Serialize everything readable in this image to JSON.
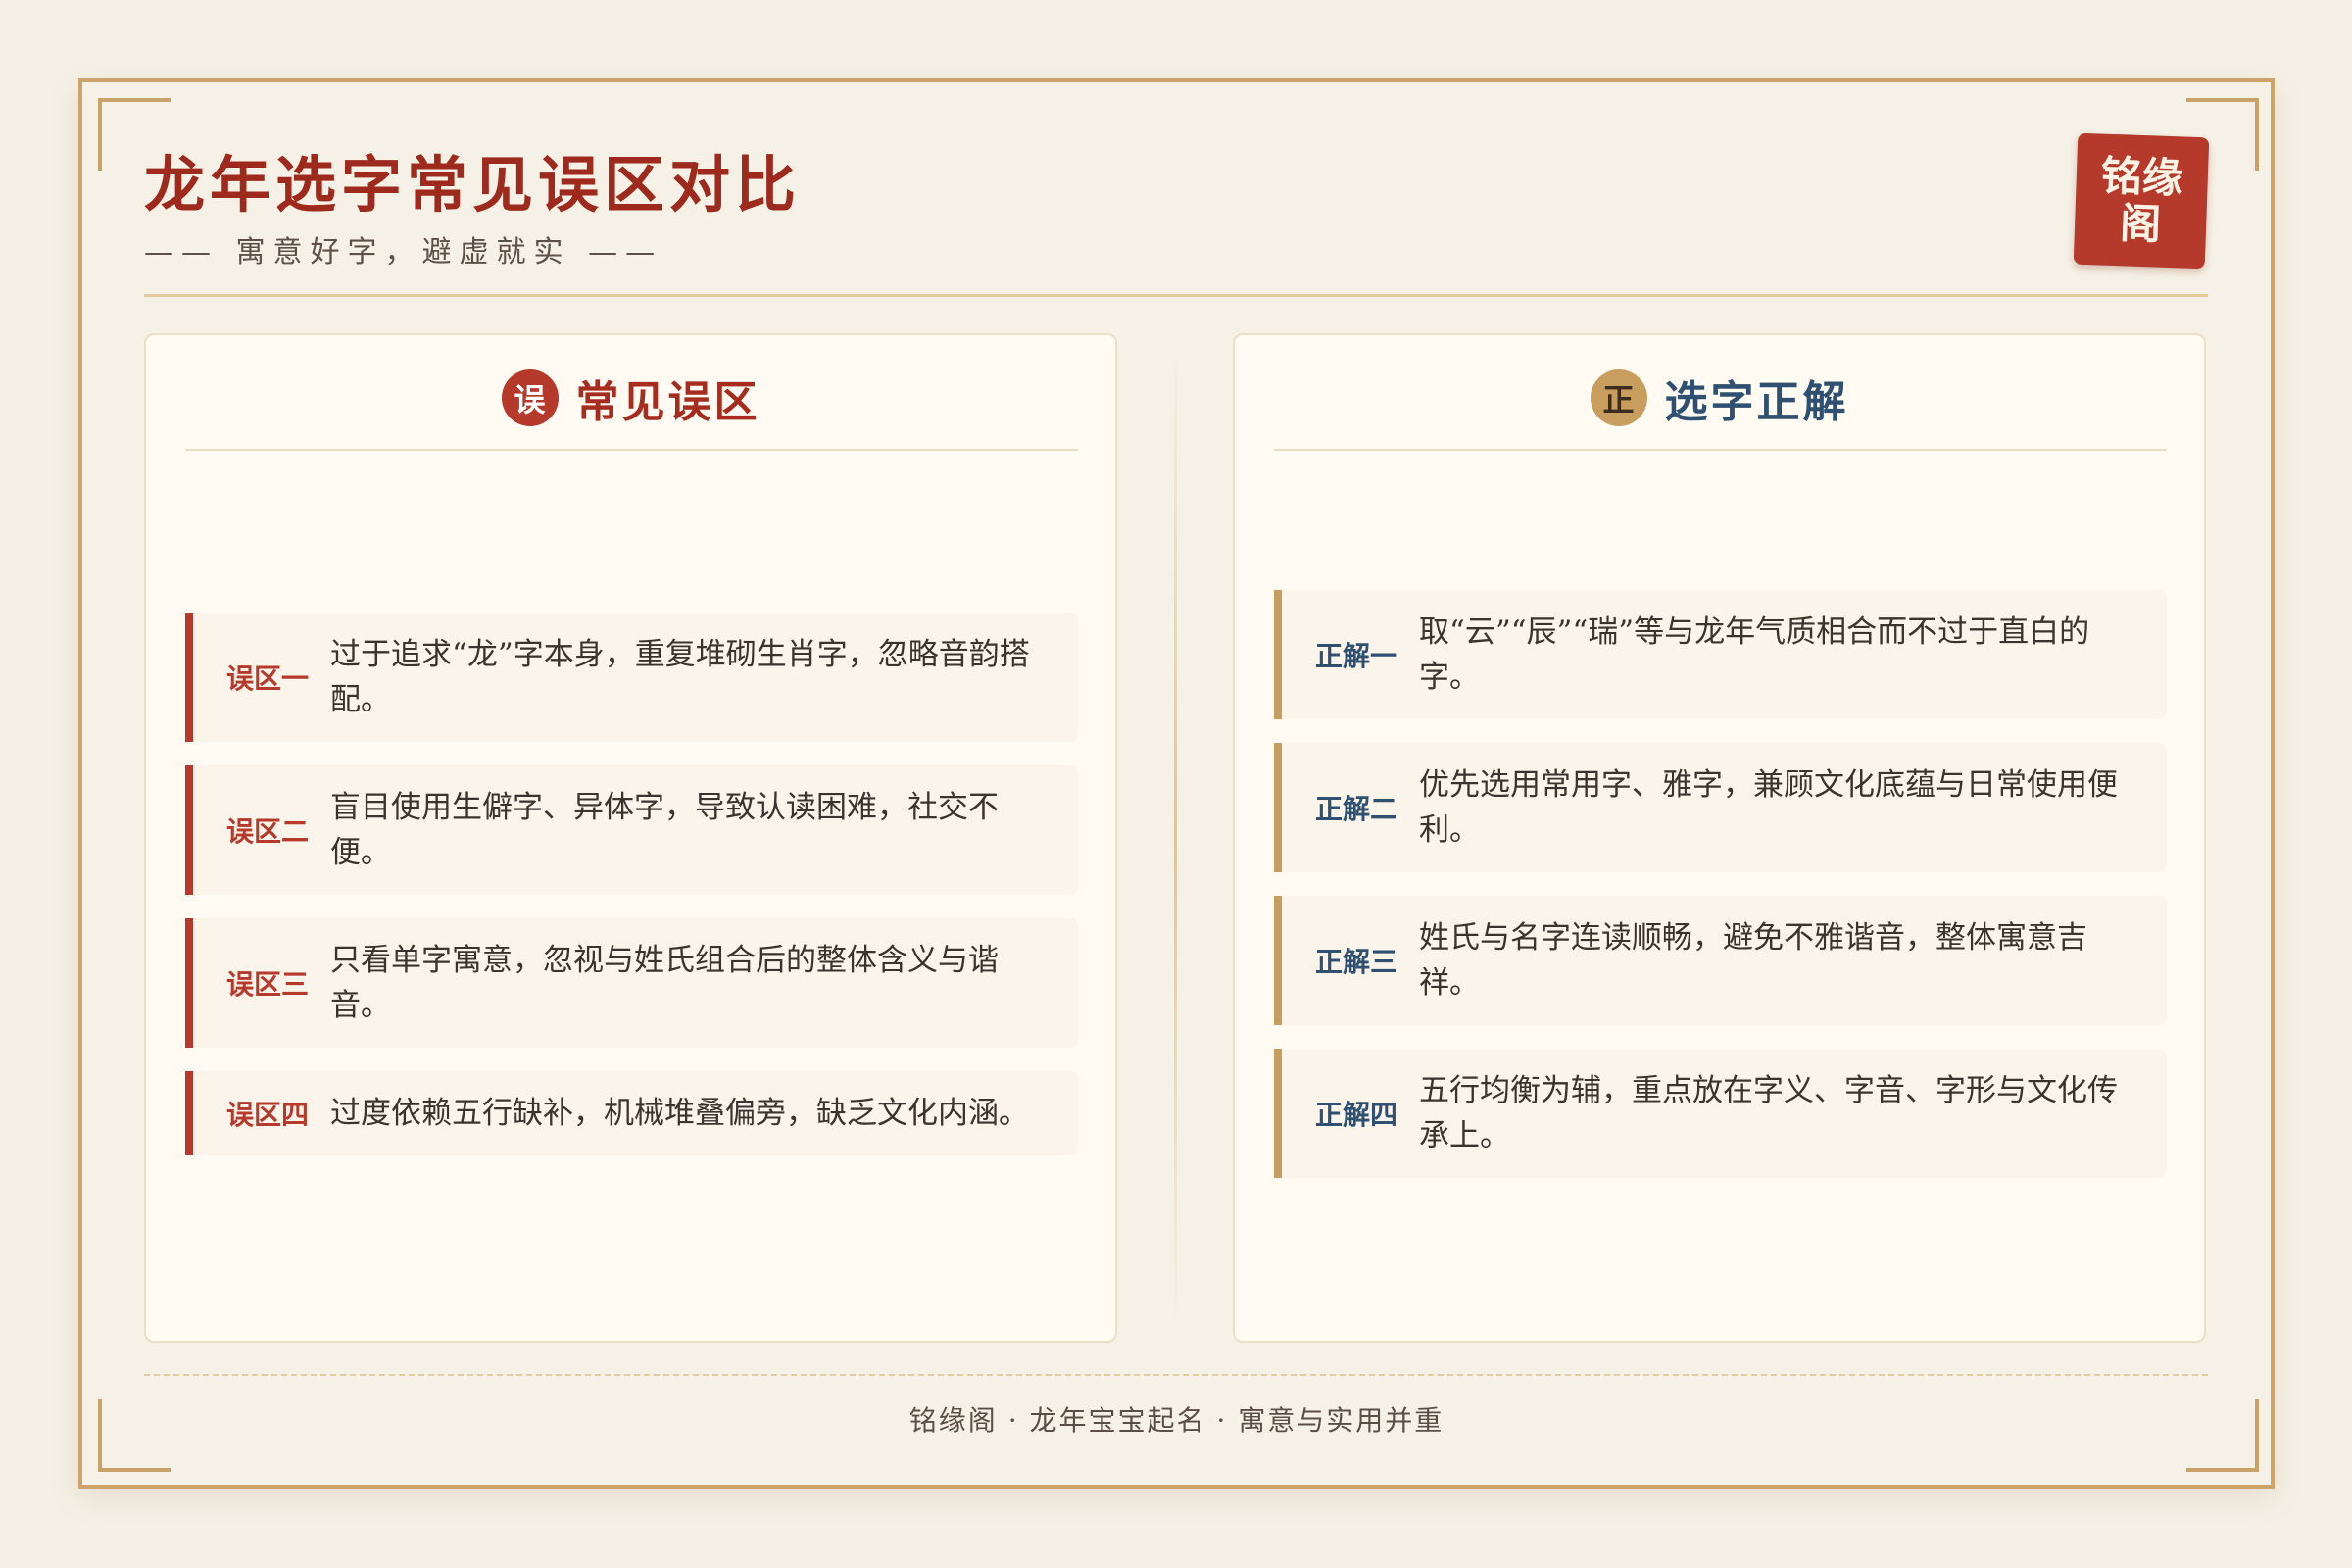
{
  "header": {
    "title": "龙年选字常见误区对比",
    "subtitle": "—— 寓意好字，避虚就实 ——",
    "seal": "铭缘阁"
  },
  "left_panel": {
    "badge": "误",
    "title": "常见误区",
    "items": [
      {
        "tag": "误区一",
        "text": "过于追求“龙”字本身，重复堆砌生肖字，忽略音韵搭配。"
      },
      {
        "tag": "误区二",
        "text": "盲目使用生僻字、异体字，导致认读困难，社交不便。"
      },
      {
        "tag": "误区三",
        "text": "只看单字寓意，忽视与姓氏组合后的整体含义与谐音。"
      },
      {
        "tag": "误区四",
        "text": "过度依赖五行缺补，机械堆叠偏旁，缺乏文化内涵。"
      }
    ]
  },
  "right_panel": {
    "badge": "正",
    "title": "选字正解",
    "items": [
      {
        "tag": "正解一",
        "text": "取“云”“辰”“瑞”等与龙年气质相合而不过于直白的字。"
      },
      {
        "tag": "正解二",
        "text": "优先选用常用字、雅字，兼顾文化底蕴与日常使用便利。"
      },
      {
        "tag": "正解三",
        "text": "姓氏与名字连读顺畅，避免不雅谐音，整体寓意吉祥。"
      },
      {
        "tag": "正解四",
        "text": "五行均衡为辅，重点放在字义、字音、字形与文化传承上。"
      }
    ]
  },
  "footer": {
    "text": "铭缘阁 · 龙年宝宝起名 · 寓意与实用并重"
  },
  "colors": {
    "accent_red": "#b53a2b",
    "accent_gold": "#c89d5e",
    "title_blue": "#2f5070",
    "background": "#f5f0e6"
  }
}
